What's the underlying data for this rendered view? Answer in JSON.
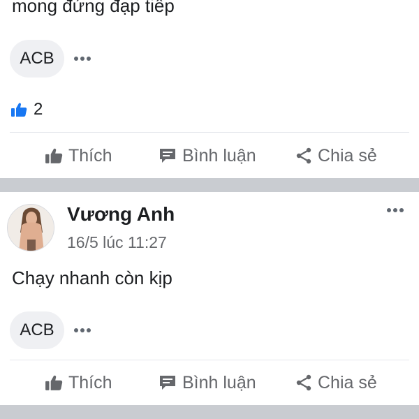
{
  "post_previous": {
    "text_fragment": "mong đứng đạp tiếp",
    "tag_chip": "ACB",
    "like_count": "2",
    "actions": {
      "like": "Thích",
      "comment": "Bình luận",
      "share": "Chia sẻ"
    }
  },
  "post_current": {
    "author": "Vương Anh",
    "timestamp": "16/5 lúc 11:27",
    "body": "Chạy nhanh còn kịp",
    "tag_chip": "ACB",
    "actions": {
      "like": "Thích",
      "comment": "Bình luận",
      "share": "Chia sẻ"
    }
  },
  "colors": {
    "like_blue": "#1877f2",
    "muted_text": "#65676b",
    "separator": "#c9ccd1"
  }
}
